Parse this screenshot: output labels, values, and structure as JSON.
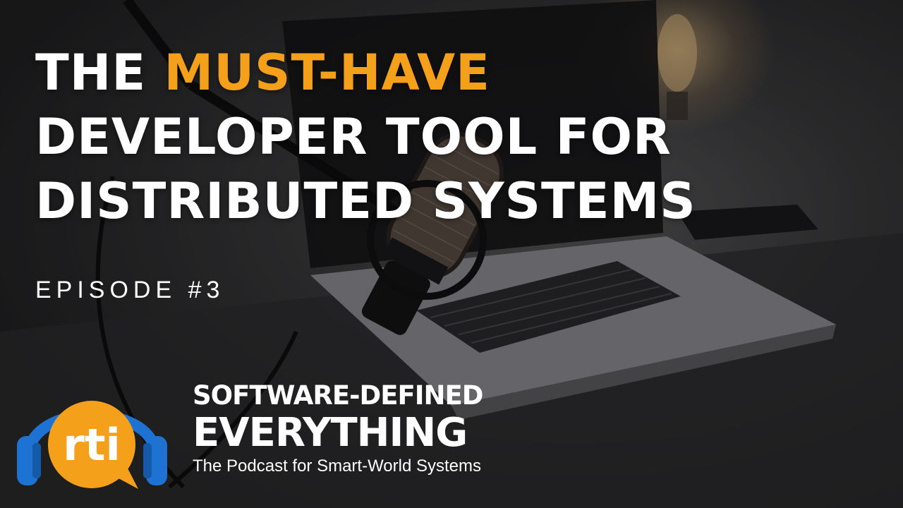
{
  "headline": {
    "line1_pre": "THE ",
    "line1_highlight": "MUST-HAVE",
    "line2": "DEVELOPER TOOL FOR",
    "line3": "DISTRIBUTED SYSTEMS"
  },
  "episode_label": "EPISODE #3",
  "logo": {
    "icon_text": "rti",
    "icon_name": "headphones-chat-bubble-icon",
    "title_line1": "SOFTWARE-DEFINED",
    "title_line2": "EVERYTHING",
    "tagline": "The Podcast for Smart-World Systems"
  },
  "colors": {
    "accent": "#f5a01a",
    "headphone_blue": "#1e73d2",
    "text": "#ffffff"
  }
}
